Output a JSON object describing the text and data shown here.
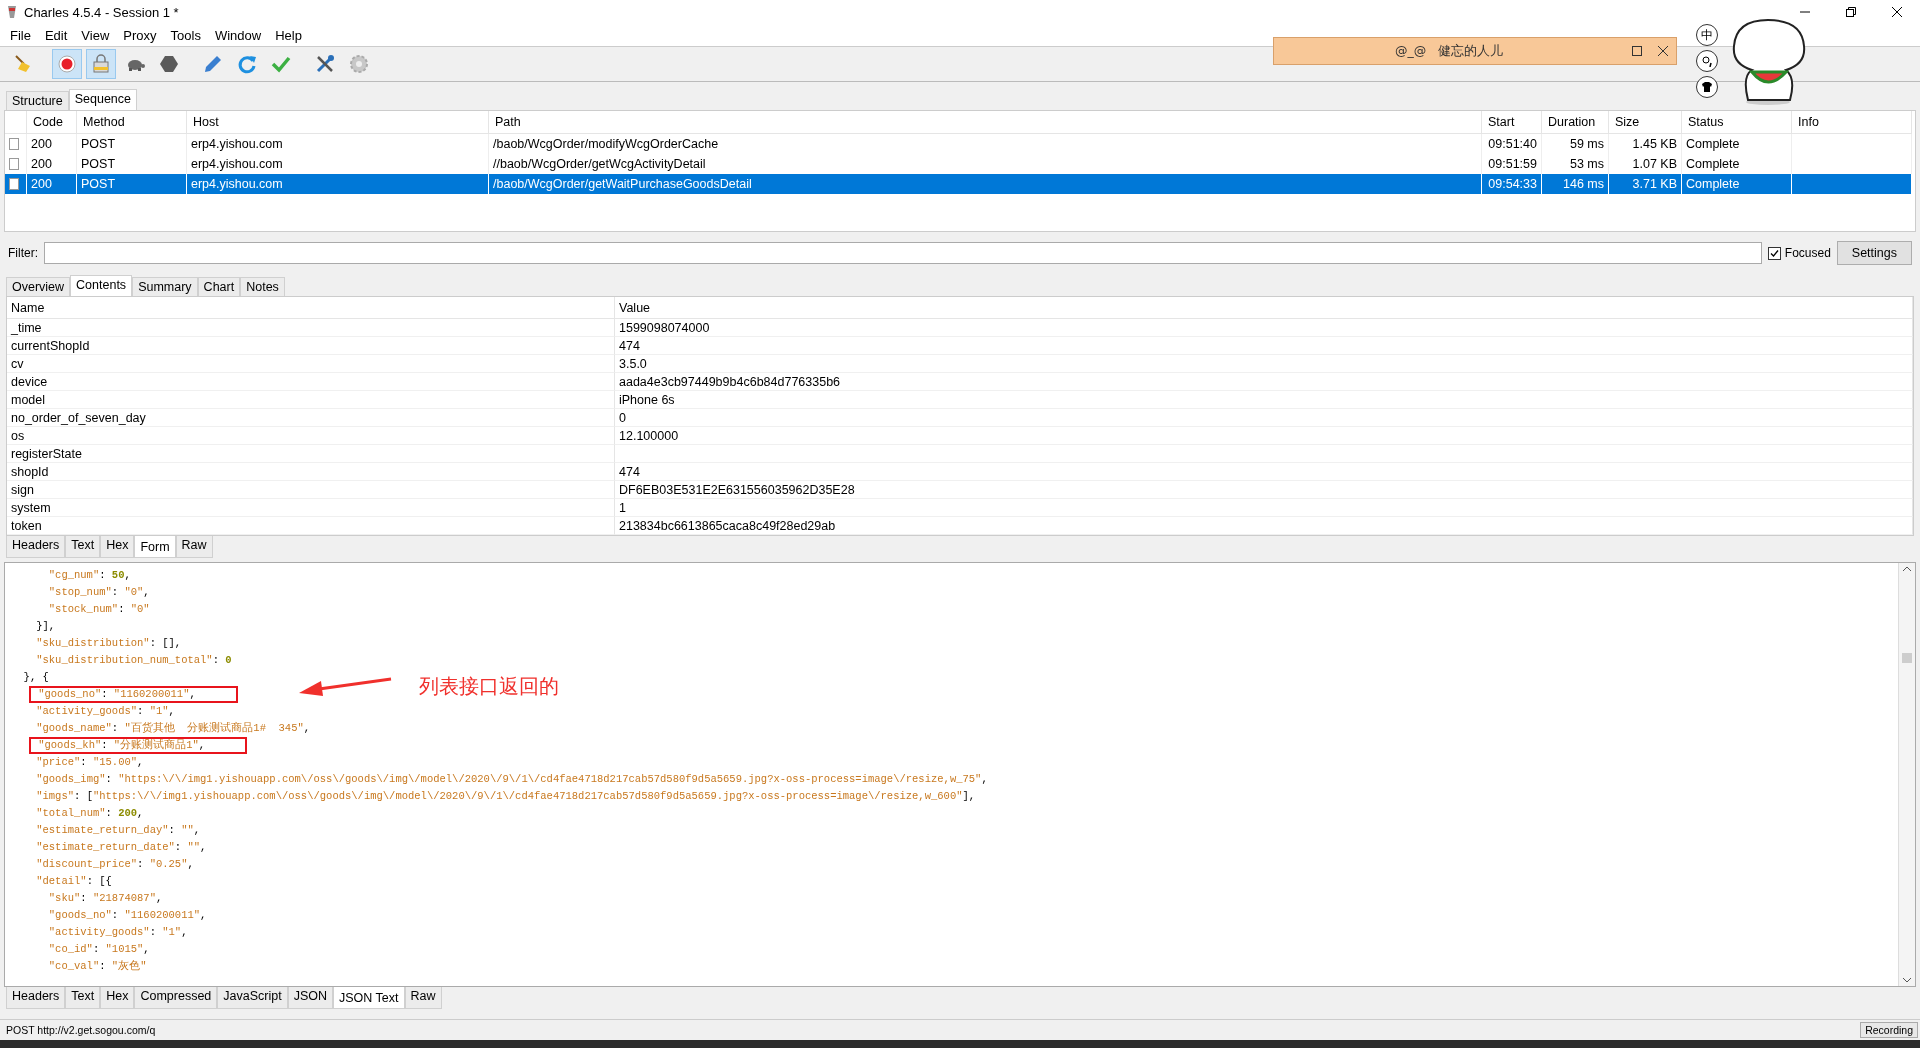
{
  "window": {
    "title": "Charles 4.5.4 - Session 1 *"
  },
  "menu": [
    {
      "label": "File"
    },
    {
      "label": "Edit"
    },
    {
      "label": "View"
    },
    {
      "label": "Proxy"
    },
    {
      "label": "Tools"
    },
    {
      "label": "Window"
    },
    {
      "label": "Help"
    }
  ],
  "toolbar": [
    {
      "pressed": false
    },
    {
      "pressed": true
    },
    {
      "pressed": true
    },
    {
      "pressed": false
    },
    {
      "pressed": false
    },
    {
      "pressed": false
    },
    {
      "pressed": false
    },
    {
      "pressed": false
    },
    {
      "pressed": false
    },
    {
      "pressed": false
    }
  ],
  "view_tabs": [
    {
      "label": "Structure",
      "selected": false
    },
    {
      "label": "Sequence",
      "selected": true
    }
  ],
  "requests": {
    "columns": [
      "Code",
      "Method",
      "Host",
      "Path",
      "Start",
      "Duration",
      "Size",
      "Status",
      "Info"
    ],
    "rows": [
      {
        "selected": false,
        "cells": [
          "200",
          "POST",
          "erp4.yishou.com",
          "/baob/WcgOrder/modifyWcgOrderCache",
          "09:51:40",
          "59 ms",
          "1.45 KB",
          "Complete"
        ]
      },
      {
        "selected": false,
        "cells": [
          "200",
          "POST",
          "erp4.yishou.com",
          "//baob/WcgOrder/getWcgActivityDetail",
          "09:51:59",
          "53 ms",
          "1.07 KB",
          "Complete"
        ]
      },
      {
        "selected": true,
        "cells": [
          "200",
          "POST",
          "erp4.yishou.com",
          "/baob/WcgOrder/getWaitPurchaseGoodsDetail",
          "09:54:33",
          "146 ms",
          "3.71 KB",
          "Complete"
        ]
      }
    ]
  },
  "filter": {
    "label": "Filter:",
    "focused": {
      "label": "Focused",
      "checked": true
    },
    "settings": "Settings"
  },
  "detail_tabs": [
    {
      "label": "Overview",
      "selected": false
    },
    {
      "label": "Contents",
      "selected": true
    },
    {
      "label": "Summary",
      "selected": false
    },
    {
      "label": "Chart",
      "selected": false
    },
    {
      "label": "Notes",
      "selected": false
    }
  ],
  "form": {
    "columns": [
      "Name",
      "Value"
    ],
    "rows": [
      [
        "_time",
        "1599098074000"
      ],
      [
        "currentShopId",
        "474"
      ],
      [
        "cv",
        "3.5.0"
      ],
      [
        "device",
        "aada4e3cb97449b9b4c6b84d776335b6"
      ],
      [
        "model",
        "iPhone 6s"
      ],
      [
        "no_order_of_seven_day",
        "0"
      ],
      [
        "os",
        "12.100000"
      ],
      [
        "registerState"
      ],
      [
        "shopId",
        "474"
      ],
      [
        "sign",
        "DF6EB03E531E2E631556035962D35E28"
      ],
      [
        "system",
        "1"
      ],
      [
        "token",
        "213834bc6613865caca8c49f28ed29ab"
      ]
    ]
  },
  "request_tabs": [
    {
      "label": "Headers",
      "selected": false
    },
    {
      "label": "Text",
      "selected": false
    },
    {
      "label": "Hex",
      "selected": false
    },
    {
      "label": "Form",
      "selected": true
    },
    {
      "label": "Raw",
      "selected": false
    }
  ],
  "json_lines": [
    {
      "text": "      \"cg_num\": 50,",
      "boxed": false
    },
    {
      "text": "      \"stop_num\": \"0\",",
      "boxed": false
    },
    {
      "text": "      \"stock_num\": \"0\"",
      "boxed": false
    },
    {
      "text": "    }],",
      "boxed": false
    },
    {
      "text": "    \"sku_distribution\": [],",
      "boxed": false
    },
    {
      "text": "    \"sku_distribution_num_total\": 0",
      "boxed": false
    },
    {
      "text": "  }, {",
      "boxed": false
    },
    {
      "text": "    \"goods_no\": \"1160200011\",",
      "boxed": true
    },
    {
      "text": "    \"activity_goods\": \"1\",",
      "boxed": false
    },
    {
      "text": "    \"goods_name\": \"百货其他  分账测试商品1#  345\",",
      "boxed": false
    },
    {
      "text": "    \"goods_kh\": \"分账测试商品1\",",
      "boxed": true
    },
    {
      "text": "    \"price\": \"15.00\",",
      "boxed": false
    },
    {
      "text": "    \"goods_img\": \"https:\\/\\/img1.yishouapp.com\\/oss\\/goods\\/img\\/model\\/2020\\/9\\/1\\/cd4fae4718d217cab57d580f9d5a5659.jpg?x-oss-process=image\\/resize,w_75\",",
      "boxed": false
    },
    {
      "text": "    \"imgs\": [\"https:\\/\\/img1.yishouapp.com\\/oss\\/goods\\/img\\/model\\/2020\\/9\\/1\\/cd4fae4718d217cab57d580f9d5a5659.jpg?x-oss-process=image\\/resize,w_600\"],",
      "boxed": false
    },
    {
      "text": "    \"total_num\": 200,",
      "boxed": false
    },
    {
      "text": "    \"estimate_return_day\": \"\",",
      "boxed": false
    },
    {
      "text": "    \"estimate_return_date\": \"\",",
      "boxed": false
    },
    {
      "text": "    \"discount_price\": \"0.25\",",
      "boxed": false
    },
    {
      "text": "    \"detail\": [{",
      "boxed": false
    },
    {
      "text": "      \"sku\": \"21874087\",",
      "boxed": false
    },
    {
      "text": "      \"goods_no\": \"1160200011\",",
      "boxed": false
    },
    {
      "text": "      \"activity_goods\": \"1\",",
      "boxed": false
    },
    {
      "text": "      \"co_id\": \"1015\",",
      "boxed": false
    },
    {
      "text": "      \"co_val\": \"灰色\"",
      "boxed": false
    }
  ],
  "annotation": {
    "text": "列表接口返回的"
  },
  "response_tabs": [
    {
      "label": "Headers",
      "selected": false
    },
    {
      "label": "Text",
      "selected": false
    },
    {
      "label": "Hex",
      "selected": false
    },
    {
      "label": "Compressed",
      "selected": false
    },
    {
      "label": "JavaScript",
      "selected": false
    },
    {
      "label": "JSON",
      "selected": false
    },
    {
      "label": "JSON Text",
      "selected": true
    },
    {
      "label": "Raw",
      "selected": false
    }
  ],
  "status_bar": {
    "text": "POST http://v2.get.sogou.com/q",
    "recording": "Recording"
  },
  "ime_window": {
    "prefix": "@_@",
    "title": "健忘的人儿",
    "side_mark": "中"
  }
}
